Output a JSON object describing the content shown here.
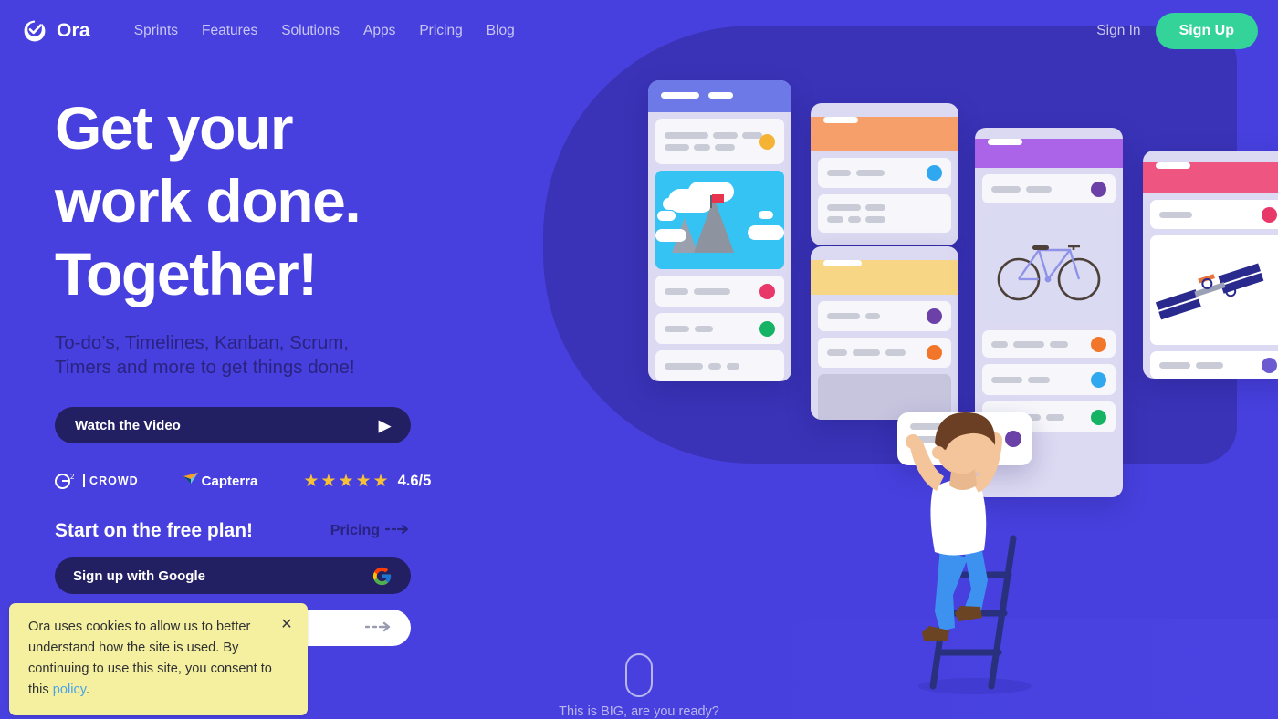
{
  "meta": {
    "brand": "Ora",
    "accent_green": "#34d399",
    "bg_purple": "#4740de",
    "bg_dark_purple": "#3a33b8",
    "dark_button": "#231f63"
  },
  "header": {
    "logo_icon": "ora-check-logo-icon",
    "brand_name": "Ora",
    "nav": [
      {
        "label": "Sprints"
      },
      {
        "label": "Features"
      },
      {
        "label": "Solutions"
      },
      {
        "label": "Apps"
      },
      {
        "label": "Pricing"
      },
      {
        "label": "Blog"
      }
    ],
    "sign_in": "Sign In",
    "sign_up": "Sign Up"
  },
  "hero": {
    "headline_line1": "Get your",
    "headline_line2": "work done.",
    "headline_line3": "Together!",
    "subhead_line1": "To-do’s, Timelines, Kanban, Scrum,",
    "subhead_line2": "Timers and more to get things done!",
    "video_button": "Watch the Video",
    "video_icon": "play-triangle-icon",
    "ratings": {
      "g2_sup": "2",
      "g2_word": "CROWD",
      "capterra_word": "Capterra",
      "capterra_icon": "capterra-paper-plane-icon",
      "stars": [
        "★",
        "★",
        "★",
        "★",
        "★"
      ],
      "score": "4.6/5"
    },
    "free_plan_title": "Start on the free plan!",
    "pricing_link": "Pricing",
    "pricing_arrow_icon": "dashed-arrow-right-icon",
    "google_button": "Sign up with Google",
    "google_icon": "google-g-icon",
    "email_button_arrow_icon": "dashed-arrow-right-icon"
  },
  "cookie_banner": {
    "text_part1": "Ora uses cookies to allow us to better understand how the site is used. By continuing to use this site, you consent to this ",
    "policy_link": "policy",
    "text_part2": ".",
    "close_icon": "close-x-icon"
  },
  "scroll_indicator": {
    "mouse_icon": "mouse-scroll-icon",
    "text": "This is BIG, are you ready?"
  },
  "illustration": {
    "name": "kanban-board-cards-illustration",
    "cards": [
      {
        "name": "card-blue",
        "header_color": "#6e79e8",
        "dots": [
          "#f5b335",
          "#e8386a",
          "#16b364"
        ],
        "has_picture": true,
        "picture": "mountain-summit-with-flag-image"
      },
      {
        "name": "card-orange",
        "header_color": "#f79f6a",
        "dots": [
          "#2fa8f0"
        ]
      },
      {
        "name": "card-yellow",
        "header_color": "#f7d786",
        "dots": [
          "#6b41a8",
          "#f2762a"
        ]
      },
      {
        "name": "card-purple",
        "header_color": "#ab63e8",
        "dots": [
          "#6b41a8",
          "#f2762a",
          "#2fa8f0",
          "#16b364"
        ],
        "has_picture": true,
        "picture": "bicycle-line-drawing-image"
      },
      {
        "name": "card-pink",
        "header_color": "#ee5580",
        "dots": [
          "#e8386a",
          "#6b5ad0"
        ],
        "has_picture": true,
        "picture": "space-station-drawing-image"
      }
    ],
    "person": {
      "name": "person-on-ladder-illustration",
      "shirt_color": "#ffffff",
      "jeans_color": "#3d92f0",
      "hair_color": "#6b3f23",
      "ladder_color": "#29307e"
    },
    "floating_card": {
      "name": "floating-task-card",
      "dot": "#6b41a8"
    }
  }
}
